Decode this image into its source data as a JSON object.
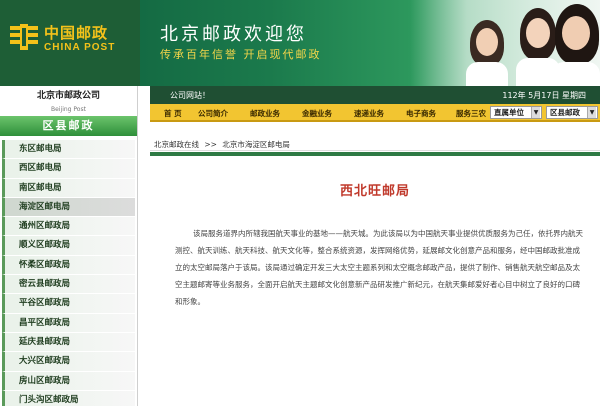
{
  "brand": {
    "logo_cn": "中国邮政",
    "logo_en": "CHINA POST",
    "welcome": "北京邮政欢迎您",
    "slogan": "传承百年信誉    开启现代邮政"
  },
  "sidebar": {
    "company": "北京市邮政公司",
    "company_en": "Beijing Post",
    "section_title": "区县邮政",
    "items": [
      {
        "label": "东区邮电局"
      },
      {
        "label": "西区邮电局"
      },
      {
        "label": "南区邮电局"
      },
      {
        "label": "海淀区邮电局"
      },
      {
        "label": "通州区邮政局"
      },
      {
        "label": "顺义区邮政局"
      },
      {
        "label": "怀柔区邮政局"
      },
      {
        "label": "密云县邮政局"
      },
      {
        "label": "平谷区邮政局"
      },
      {
        "label": "昌平区邮政局"
      },
      {
        "label": "延庆县邮政局"
      },
      {
        "label": "大兴区邮政局"
      },
      {
        "label": "房山区邮政局"
      },
      {
        "label": "门头沟区邮政局"
      }
    ],
    "active_index": 3
  },
  "infobar": {
    "notice": "公司网站！",
    "date": "112年 5月17日  星期四"
  },
  "menu": {
    "items": [
      "首 页",
      "公司简介",
      "邮政业务",
      "金融业务",
      "速递业务",
      "电子商务",
      "服务三农"
    ],
    "select_units": "直属单位",
    "select_district": "区县邮政"
  },
  "breadcrumb": {
    "root": "北京邮政在线",
    "sep": ">>",
    "current": "北京市海淀区邮电局"
  },
  "article": {
    "title": "西北旺邮局",
    "body": "该局服务道界内所辖我国航天事业的基地——航天城。为此该局以为中国航天事业提供优质服务为己任，依托界内航天测控、航天训练、航天科技、航天文化等，整合系统资源，发挥网络优势，延展邮文化创意产品和服务，经中国邮政批准成立的太空邮局落户于该局。该局通过确定开发三大太空主题系列和太空概念邮政产品，提供了制作、销售航天航空邮品及太空主题邮寄等业务服务，全面开启航天主题邮文化创意新产品研发推广新纪元，在航天集邮爱好者心目中树立了良好的口碑和形象。"
  },
  "colors": {
    "brand_green": "#1e5e36",
    "menu_yellow": "#f2c531",
    "title_red": "#c0392b"
  }
}
